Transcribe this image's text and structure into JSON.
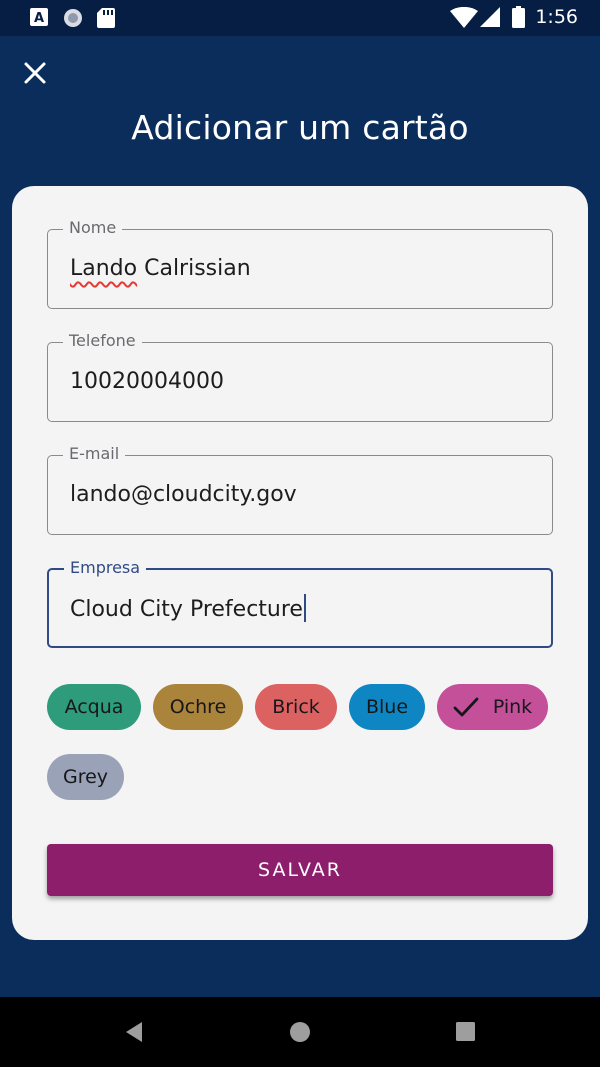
{
  "status_bar": {
    "time": "1:56",
    "icons": [
      "text-a-icon",
      "circle-icon",
      "sd-card-icon",
      "wifi-icon",
      "signal-icon",
      "battery-icon"
    ]
  },
  "dialog": {
    "title": "Adicionar um cartão",
    "close_icon": "close-icon"
  },
  "form": {
    "fields": [
      {
        "label": "Nome",
        "value_first": "Lando",
        "value_rest": " Calrissian"
      },
      {
        "label": "Telefone",
        "value": "10020004000"
      },
      {
        "label": "E-mail",
        "value": "lando@cloudcity.gov"
      },
      {
        "label": "Empresa",
        "value": "Cloud City Prefecture"
      }
    ],
    "colors": [
      {
        "label": "Acqua",
        "color": "#2e9b7a"
      },
      {
        "label": "Ochre",
        "color": "#a9843a"
      },
      {
        "label": "Brick",
        "color": "#dc6261"
      },
      {
        "label": "Blue",
        "color": "#0e86c3"
      },
      {
        "label": "Pink",
        "color": "#c4509a",
        "selected": true
      },
      {
        "label": "Grey",
        "color": "#9aa2b8"
      }
    ],
    "save_label": "SALVAR"
  },
  "theme": {
    "background": "#0b2d5b",
    "status_bar": "#061d44",
    "card": "#f4f4f5",
    "accent": "#2f4a85",
    "save_button": "#8d1e6c"
  },
  "nav_bar": {
    "icons": [
      "back-icon",
      "home-icon",
      "recents-icon"
    ]
  }
}
